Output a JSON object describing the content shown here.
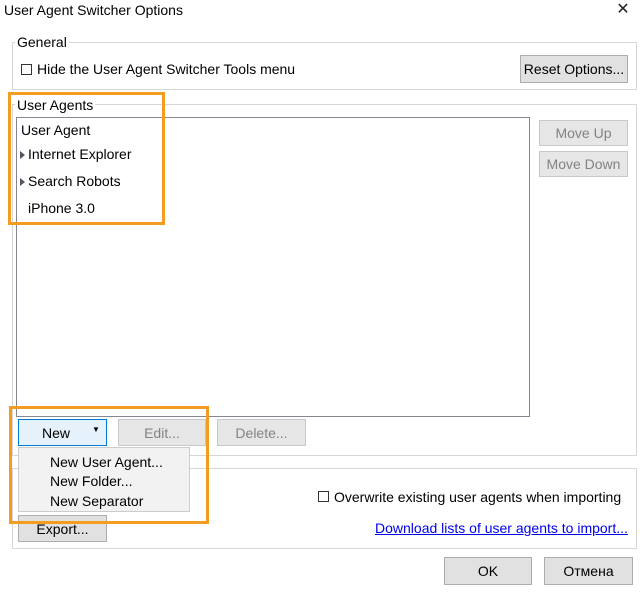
{
  "window": {
    "title": "User Agent Switcher Options"
  },
  "general": {
    "legend": "General",
    "hide_menu_label": "Hide the User Agent Switcher Tools menu",
    "reset_button": "Reset Options..."
  },
  "user_agents": {
    "legend": "User Agents",
    "header": "User Agent",
    "items": [
      {
        "label": "Internet Explorer",
        "type": "folder"
      },
      {
        "label": "Search Robots",
        "type": "folder"
      },
      {
        "label": "iPhone 3.0",
        "type": "agent"
      }
    ],
    "move_up": "Move Up",
    "move_down": "Move Down",
    "new_button": "New",
    "edit_button": "Edit...",
    "delete_button": "Delete..."
  },
  "new_menu": {
    "items": [
      "New User Agent...",
      "New Folder...",
      "New Separator"
    ]
  },
  "import_export": {
    "overwrite_label": "Overwrite existing user agents when importing",
    "export_button": "Export...",
    "download_link": "Download lists of user agents to import..."
  },
  "footer": {
    "ok": "OK",
    "cancel": "Отмена"
  }
}
